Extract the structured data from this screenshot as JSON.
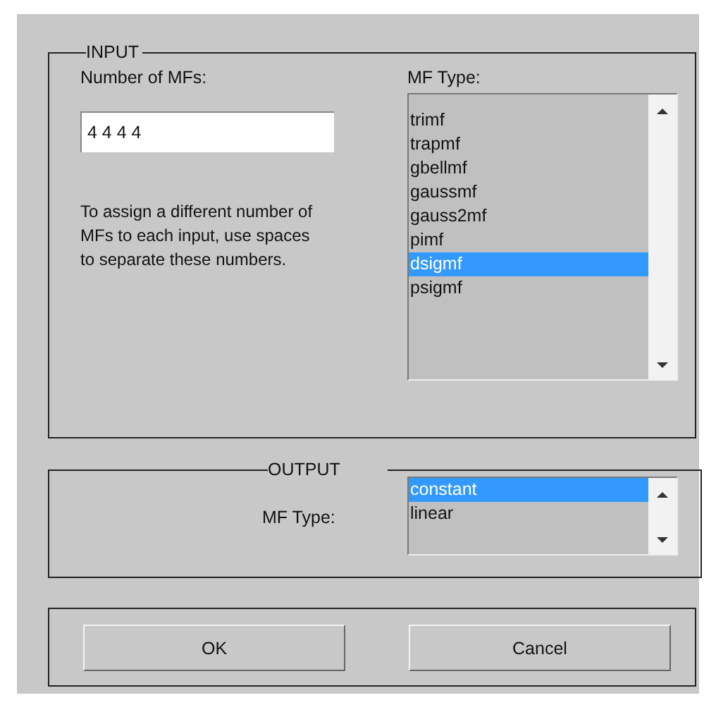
{
  "input": {
    "title": "INPUT",
    "count_label": "Number of MFs:",
    "count_field": {
      "value": "4 4 4 4"
    },
    "help": "To assign a different number of MFs to each input, use spaces to separate these numbers.",
    "type_label": "MF Type:",
    "types": [
      {
        "label": "trimf",
        "selected": false
      },
      {
        "label": "trapmf",
        "selected": false
      },
      {
        "label": "gbellmf",
        "selected": false
      },
      {
        "label": "gaussmf",
        "selected": false
      },
      {
        "label": "gauss2mf",
        "selected": false
      },
      {
        "label": "pimf",
        "selected": false
      },
      {
        "label": "dsigmf",
        "selected": true
      },
      {
        "label": "psigmf",
        "selected": false
      }
    ]
  },
  "output": {
    "title": "OUTPUT",
    "type_label": "MF Type:",
    "types": [
      {
        "label": "constant",
        "selected": true
      },
      {
        "label": "linear",
        "selected": false
      }
    ]
  },
  "buttons": [
    "OK",
    "Cancel"
  ]
}
